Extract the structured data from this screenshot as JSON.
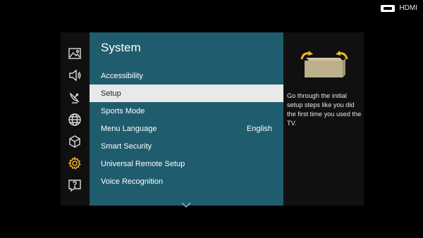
{
  "status": {
    "input_source": "HDMI",
    "input_icon": "hdmi-icon"
  },
  "sidebar": {
    "icons": [
      {
        "name": "picture-icon"
      },
      {
        "name": "sound-icon"
      },
      {
        "name": "broadcasting-icon"
      },
      {
        "name": "network-icon"
      },
      {
        "name": "smart-hub-icon"
      },
      {
        "name": "system-gear-icon",
        "active": true
      },
      {
        "name": "support-icon"
      }
    ]
  },
  "menu": {
    "title": "System",
    "items": [
      {
        "label": "Accessibility",
        "value": ""
      },
      {
        "label": "Setup",
        "value": "",
        "selected": true
      },
      {
        "label": "Sports Mode",
        "value": ""
      },
      {
        "label": "Menu Language",
        "value": "English"
      },
      {
        "label": "Smart Security",
        "value": ""
      },
      {
        "label": "Universal Remote Setup",
        "value": ""
      },
      {
        "label": "Voice Recognition",
        "value": ""
      }
    ],
    "more_icon": "chevron-down-icon"
  },
  "info": {
    "illustration": "setup-box-illustration",
    "description": "Go through the initial setup steps like you did the first time you used the TV."
  },
  "colors": {
    "menu_bg": "#1f5c6e",
    "selected_bg": "#e9e9e9",
    "accent": "#f0b62c"
  }
}
